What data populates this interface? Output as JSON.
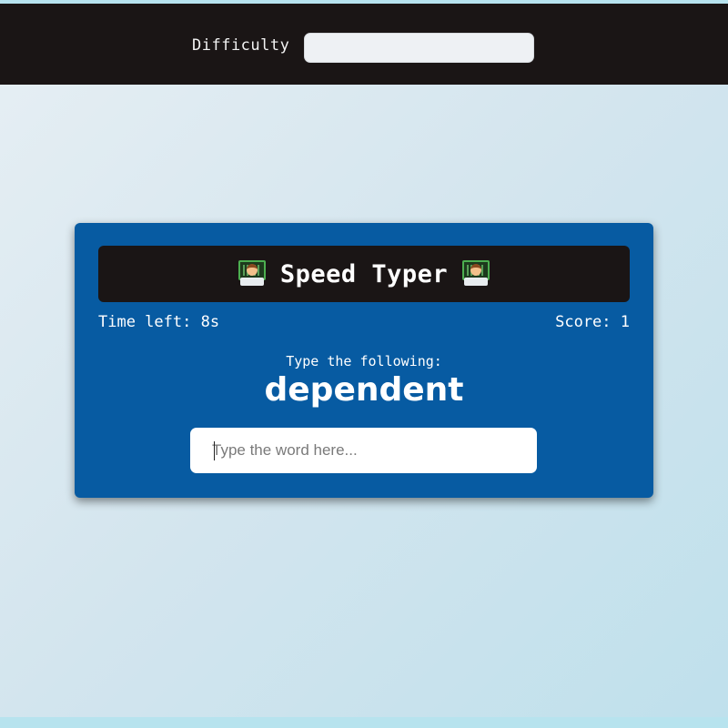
{
  "header": {
    "difficulty_label": "Difficulty",
    "difficulty_value": ""
  },
  "game": {
    "title": "Speed Typer",
    "title_icon": "technologist-emoji",
    "time_left_text": "Time left: 8s",
    "score_text": "Score: 1",
    "prompt_label": "Type the following:",
    "word": "dependent",
    "input_placeholder": "Type the word here...",
    "input_value": ""
  },
  "colors": {
    "card_background": "#075ba2",
    "header_background": "#1a1515",
    "text": "#ffffff"
  }
}
